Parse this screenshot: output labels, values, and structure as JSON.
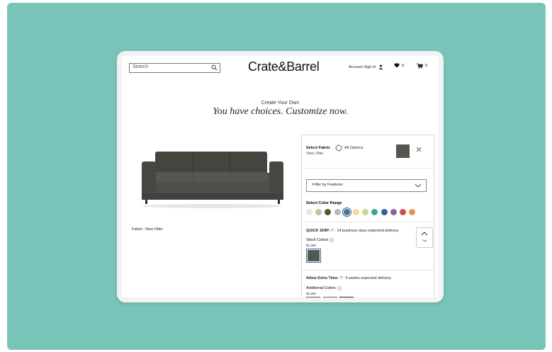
{
  "header": {
    "search_placeholder": "Search",
    "logo": "Crate&Barrel",
    "account_label": "Account Sign In",
    "wishlist_count": "0",
    "cart_count": "0"
  },
  "hero": {
    "kicker": "Create Your Own",
    "headline": "You have choices. Customize now."
  },
  "product": {
    "fabric_caption": "Fabric: View Otter"
  },
  "panel": {
    "select_title": "Select Fabric",
    "selected_fabric": "View, Otter",
    "all_options": "All Options",
    "filter_label": "Filter by Features",
    "color_range_title": "Select Color Range",
    "color_range": [
      "#e6e6e2",
      "#c9bf9c",
      "#5c5527",
      "#b9b9b9",
      "#4d7392",
      "#f3dd9a",
      "#c6d49e",
      "#38a6a0",
      "#3a5d9c",
      "#8d62a3",
      "#d24b48",
      "#e6915a"
    ],
    "selected_color_index": 4,
    "quick_ship_label": "QUICK SHIP:",
    "quick_ship_text": "7 - 14 business days expected delivery",
    "stock_colors_label": "Stock Colors",
    "stock_price": "$1,599",
    "extra_time_label": "Allow Extra Time:",
    "extra_time_text": "7 - 9 weeks expected delivery",
    "additional_colors_label": "Additional Colors",
    "additional_price": "$1,599",
    "selected_swatch_color": "#545750",
    "additional_swatches": [
      "#5f6062",
      "#6e6e6e",
      "#2b2b2b"
    ]
  },
  "back_to_top": "Top"
}
